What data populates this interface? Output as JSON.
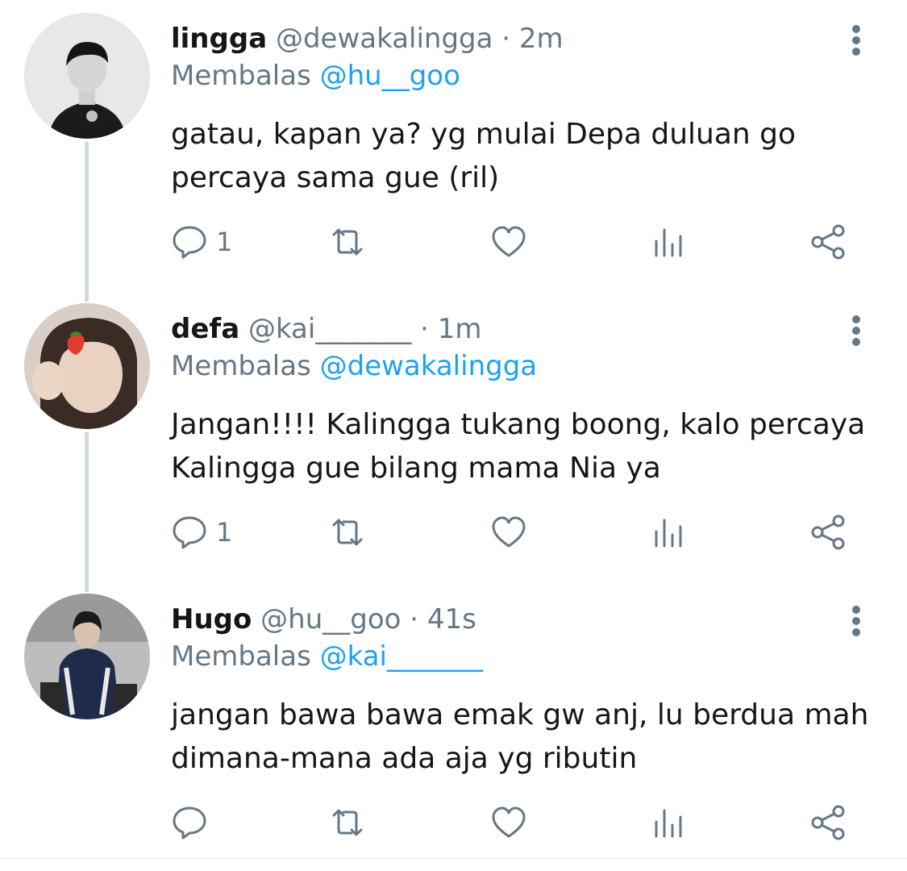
{
  "tweets": [
    {
      "name": "lingga",
      "handle": "@dewakalingga",
      "separator": "·",
      "time": "2m",
      "reply_prefix": "Membalas",
      "reply_to": "@hu__goo",
      "text_line1": "gatau, kapan ya? yg mulai Depa duluan go",
      "text_line2": "percaya sama gue (ril)",
      "reply_count": "1"
    },
    {
      "name": "defa",
      "handle": "@kai_______",
      "separator": "·",
      "time": "1m",
      "reply_prefix": "Membalas",
      "reply_to": "@dewakalingga",
      "text_line1": "Jangan!!!! Kalingga tukang boong, kalo percaya",
      "text_line2": "Kalingga gue bilang mama Nia ya",
      "reply_count": "1"
    },
    {
      "name": "Hugo",
      "handle": "@hu__goo",
      "separator": "·",
      "time": "41s",
      "reply_prefix": "Membalas",
      "reply_to": "@kai_______",
      "text_line1": "jangan bawa bawa emak gw anj, lu berdua mah",
      "text_line2": "dimana-mana ada aja yg ributin",
      "reply_count": ""
    }
  ],
  "colors": {
    "name": "#14171a",
    "muted": "#657786",
    "link": "#1da1f2",
    "thread_line": "#cfd9de"
  },
  "icons": {
    "reply": "speech-bubble-icon",
    "retweet": "retweet-arrows-icon",
    "like": "heart-outline-icon",
    "analytics": "bar-chart-icon",
    "share": "share-nodes-icon",
    "more": "vertical-dots-icon"
  }
}
